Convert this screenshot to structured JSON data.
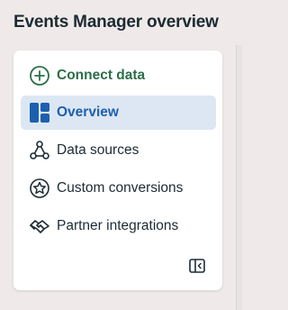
{
  "header": {
    "title": "Events Manager overview"
  },
  "nav": {
    "items": [
      {
        "label": "Connect data",
        "icon": "plus-circle-icon"
      },
      {
        "label": "Overview",
        "icon": "dashboard-icon",
        "selected": true
      },
      {
        "label": "Data sources",
        "icon": "nodes-icon"
      },
      {
        "label": "Custom conversions",
        "icon": "star-circle-icon"
      },
      {
        "label": "Partner integrations",
        "icon": "handshake-icon"
      }
    ],
    "collapse_icon": "sidebar-collapse-icon"
  },
  "colors": {
    "accent_green": "#2c6e49",
    "accent_blue": "#1d5fae",
    "selected_bg": "#dce7f3",
    "text": "#1c2b33"
  }
}
